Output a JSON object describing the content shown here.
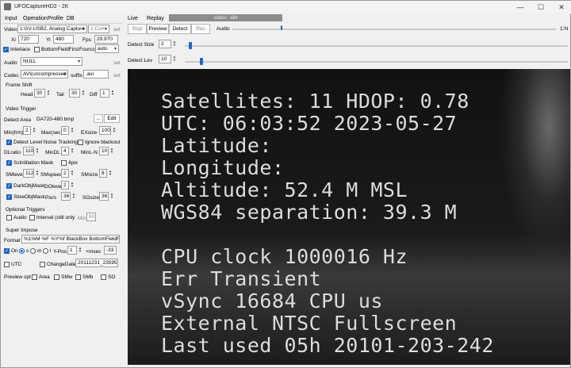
{
  "window": {
    "title": "UFOCaptureHD2 - 2K",
    "minimize": "—",
    "maximize": "☐",
    "close": "✕"
  },
  "left_tabs": [
    "Input",
    "Operation",
    "Profile",
    "DB"
  ],
  "top_tabs": [
    "Live",
    "Replay"
  ],
  "status": "status : idle",
  "toolbar": {
    "stop": "Stop",
    "preview": "Preview",
    "detect": "Detect",
    "rec": "Rec",
    "audio": "Audio",
    "ratio": "1:N"
  },
  "detect_size": {
    "label": "Detect Size",
    "value": "2",
    "slider_level": 0.01
  },
  "detect_lev": {
    "label": "Detect Lev",
    "value": "10",
    "slider_level": 0.04
  },
  "audio_level": 0.55,
  "input": {
    "video_label": "Video",
    "video_device": "1:GV-USB2, Analog Capture",
    "video_com": "1:Com",
    "set": "set",
    "xi_label": "Xi",
    "xi": "720",
    "yi_label": "Yi",
    "yi": "480",
    "fps_label": "Fps",
    "fps": "29.970",
    "interlace": "Interlace",
    "bottom_field_first": "BottomFieldFirst",
    "fourcc_label": "Fourcc",
    "fourcc": "auto",
    "audio_label": "Audio",
    "audio_device": "NULL",
    "audio_set": "set",
    "codec_label": "Codec",
    "codec": "AVI(uncompressed",
    "suffix_label": "suffix",
    "suffix": ".avi",
    "codec_set": "set"
  },
  "frame_shift": {
    "title": "Frame Shift",
    "head_label": "Head",
    "head": "30",
    "tail_label": "Tail",
    "tail": "30",
    "diff_label": "Diff",
    "diff": "1"
  },
  "video_trigger": {
    "title": "Video Trigger",
    "detect_area_label": "Detect Area",
    "detect_area": "DA720-480.bmp",
    "browse": "...",
    "edit": "Edit",
    "min_frm_label": "Min(frm)",
    "min_frm": "2",
    "max_sec_label": "Max(sec)",
    "max_sec": "0",
    "exsize_label": "EXsize",
    "exsize": "100",
    "noise_tracking": "Detect Level Noise Tracking",
    "ignore_blackout": "Ignore blackout",
    "dlratio_label": "DLratio",
    "dlratio": "110",
    "mindl_label": "MinDL",
    "mindl": "4",
    "minln_label": "MinL-N",
    "minln": "10",
    "scintillation": "Scintillation Mask",
    "fourpix": "4pix",
    "smlevel_label": "SMlevel",
    "smlevel": "112",
    "smspeed_label": "SMspeed",
    "smspeed": "2",
    "smsize_label": "SMsize",
    "smsize": "8",
    "darkobj": "DarkObjMask",
    "dolevel_label": "DOlevel",
    "dolevel": "2",
    "slowobj": "SlowObjMask",
    "pix_s_label": "Pix/s",
    "pix_s": "36",
    "sosize_label": "SOsize",
    "sosize": "36"
  },
  "optional_triggers": {
    "title": "Optional Triggers",
    "audio": "Audio",
    "interval": "Interval (still only",
    "min_label": "Min",
    "min": "60"
  },
  "super_impose": {
    "title": "Super Impose",
    "format_label": "Format",
    "format": "%1%M %F %Y%f  BlackBox BottomFieldFirst",
    "on": "On",
    "s": "s",
    "m": "m",
    "l": "l",
    "ypos_label": "Y-Pos",
    "ypos": "1",
    "msec_label": "+msec",
    "msec": "-33",
    "utc": "UTC",
    "change_date": "ChangeDate",
    "change_date_value": "20111231_235959",
    "preview_opt_label": "Preview opt",
    "area": "Area",
    "smw": "SMw",
    "smb": "SMb",
    "so": "SO"
  },
  "osd": [
    "Satellites: 11 HDOP: 0.78",
    "UTC: 06:03:52 2023-05-27",
    "Latitude:",
    "Longitude:",
    "Altitude: 52.4 M MSL",
    "WGS84 separation: 39.3 M",
    "CPU clock 1000016 Hz",
    "Err Transient",
    "vSync 16684 CPU us",
    "External NTSC Fullscreen",
    "Last used 05h 20101-203-242"
  ]
}
